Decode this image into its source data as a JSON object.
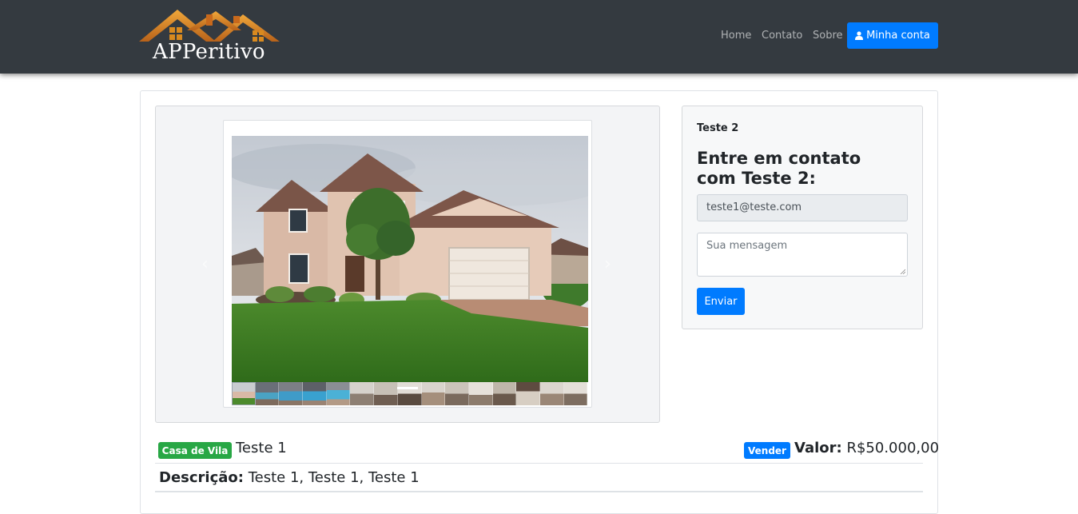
{
  "brand": {
    "name": "APPeritivo",
    "icon": "house-roofs-logo"
  },
  "nav": {
    "links": [
      {
        "label": "Home"
      },
      {
        "label": "Contato"
      },
      {
        "label": "Sobre"
      }
    ],
    "account_label": "Minha conta",
    "account_icon": "user-icon"
  },
  "gallery": {
    "prev_icon": "chevron-left-icon",
    "next_icon": "chevron-right-icon",
    "prev_glyph": "‹",
    "next_glyph": "›",
    "thumbnail_count": 15
  },
  "contact": {
    "owner_name": "Teste 2",
    "heading": "Entre em contato com Teste 2:",
    "email_value": "teste1@teste.com",
    "message_placeholder": "Sua mensagem",
    "send_label": "Enviar"
  },
  "listing": {
    "type_badge": "Casa de Vila",
    "title": "Teste 1",
    "sale_badge": "Vender",
    "price_label": "Valor:",
    "price_value": "R$50.000,00",
    "description_label": "Descrição:",
    "description_value": "Teste 1, Teste 1, Teste 1"
  },
  "colors": {
    "navbar": "#343a40",
    "primary": "#007bff",
    "success": "#28a745",
    "logo_orange": "#d98a1f"
  }
}
